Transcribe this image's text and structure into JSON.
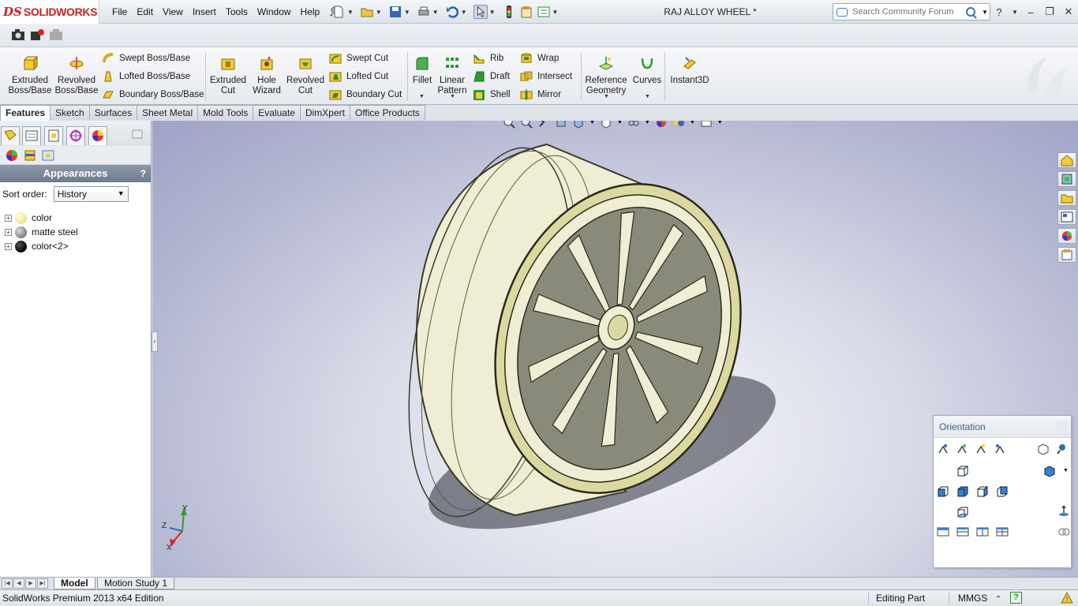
{
  "app": {
    "brand": "SOLIDWORKS",
    "brand_mark": "DS",
    "document_title": "RAJ ALLOY WHEEL *"
  },
  "menu": [
    "File",
    "Edit",
    "View",
    "Insert",
    "Tools",
    "Window",
    "Help"
  ],
  "search": {
    "placeholder": "Search Community Forum"
  },
  "command_manager": {
    "extruded_boss": "Extruded\nBoss/Base",
    "revolved_boss": "Revolved\nBoss/Base",
    "swept_boss": "Swept Boss/Base",
    "lofted_boss": "Lofted Boss/Base",
    "boundary_boss": "Boundary Boss/Base",
    "extruded_cut": "Extruded\nCut",
    "hole_wizard": "Hole\nWizard",
    "revolved_cut": "Revolved\nCut",
    "swept_cut": "Swept Cut",
    "lofted_cut": "Lofted Cut",
    "boundary_cut": "Boundary Cut",
    "fillet": "Fillet",
    "linear_pattern": "Linear\nPattern",
    "rib": "Rib",
    "draft": "Draft",
    "shell": "Shell",
    "wrap": "Wrap",
    "intersect": "Intersect",
    "mirror": "Mirror",
    "reference_geometry": "Reference\nGeometry",
    "curves": "Curves",
    "instant3d": "Instant3D"
  },
  "tabs": [
    "Features",
    "Sketch",
    "Surfaces",
    "Sheet Metal",
    "Mold Tools",
    "Evaluate",
    "DimXpert",
    "Office Products"
  ],
  "active_tab": "Features",
  "panel": {
    "title": "Appearances",
    "help": "?",
    "sort_label": "Sort order:",
    "sort_value": "History",
    "items": [
      {
        "label": "color",
        "color": "#f2eda0"
      },
      {
        "label": "matte steel",
        "color": "#8a8a8a"
      },
      {
        "label": "color<2>",
        "color": "#0a0a0a"
      }
    ]
  },
  "orientation": {
    "title": "Orientation"
  },
  "triad": {
    "x": "X",
    "y": "Y",
    "z": "Z"
  },
  "bottom_tabs": [
    "Model",
    "Motion Study 1"
  ],
  "status": {
    "edition": "SolidWorks Premium 2013 x64 Edition",
    "mode": "Editing Part",
    "units": "MMGS",
    "units_arrow": "⌃",
    "help": "?"
  },
  "colors": {
    "brand_red": "#cc1f1f",
    "model_body": "#efeed4",
    "model_rim": "#dcd9a0",
    "panel_header": "#7a8799"
  }
}
